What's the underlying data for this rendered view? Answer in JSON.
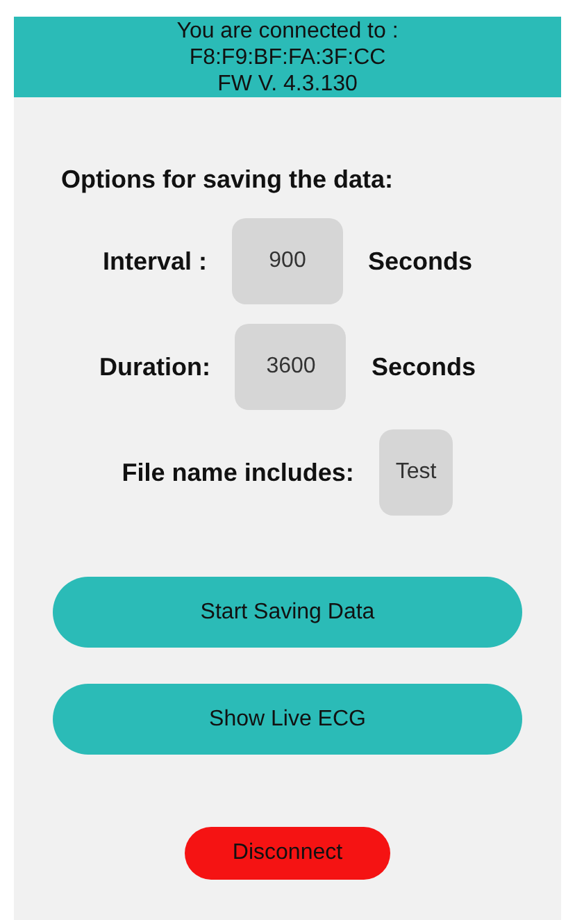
{
  "header": {
    "lines": [
      "You are connected to :",
      "F8:F9:BF:FA:3F:CC",
      "FW V. 4.3.130"
    ]
  },
  "options_title": "Options for saving the data:",
  "fields": [
    {
      "label": "Interval :",
      "value": "900",
      "unit": "Seconds"
    },
    {
      "label": "Duration:",
      "value": "3600",
      "unit": "Seconds"
    },
    {
      "label": "File name includes:",
      "value": "Test"
    }
  ],
  "buttons": [
    {
      "label": "Start Saving Data",
      "kind": "primary"
    },
    {
      "label": "Show Live ECG",
      "kind": "primary"
    },
    {
      "label": "Disconnect",
      "kind": "danger"
    }
  ]
}
